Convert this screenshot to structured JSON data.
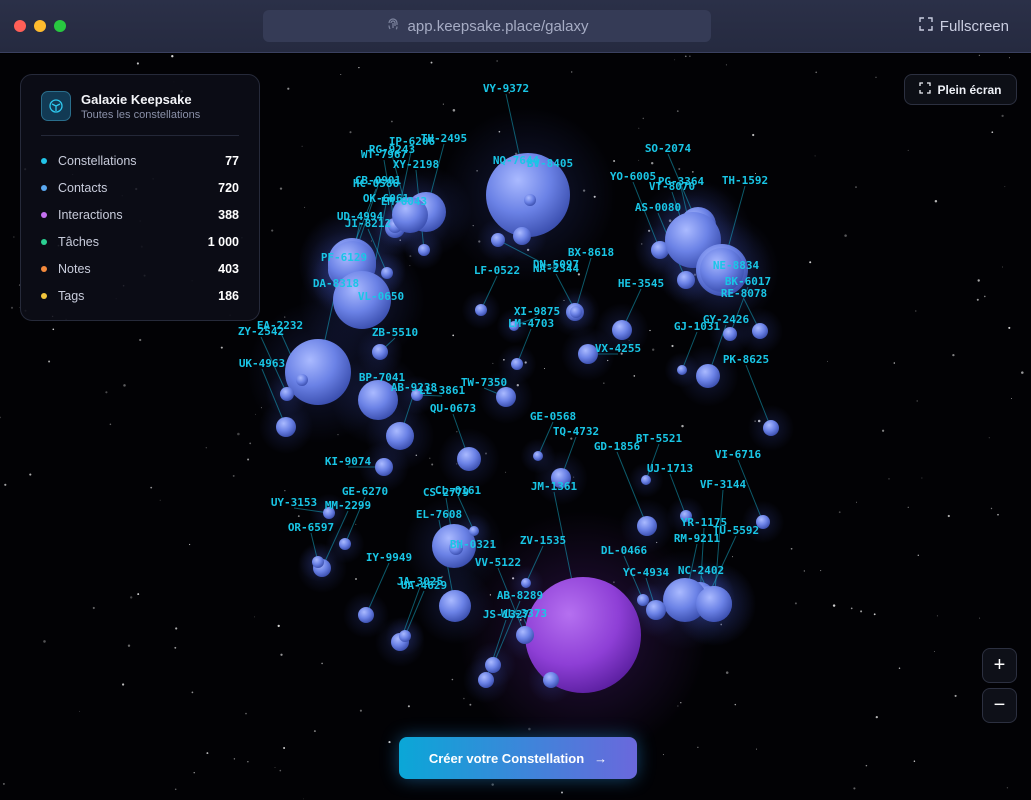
{
  "browser": {
    "url": "app.keepsake.place/galaxy",
    "fullscreen_label": "Fullscreen",
    "traffic_lights": [
      "#ff5f57",
      "#febc2e",
      "#28c840"
    ]
  },
  "panel": {
    "title": "Galaxie Keepsake",
    "subtitle": "Toutes les constellations",
    "stats": [
      {
        "label": "Constellations",
        "value": "77",
        "color": "#22c4e8"
      },
      {
        "label": "Contacts",
        "value": "720",
        "color": "#5aa8f0"
      },
      {
        "label": "Interactions",
        "value": "388",
        "color": "#c471f0"
      },
      {
        "label": "Tâches",
        "value": "1 000",
        "color": "#2bd192"
      },
      {
        "label": "Notes",
        "value": "403",
        "color": "#f48a3c"
      },
      {
        "label": "Tags",
        "value": "186",
        "color": "#f2c53c"
      }
    ]
  },
  "controls": {
    "fullscreen_label": "Plein écran",
    "zoom_in": "+",
    "zoom_out": "−",
    "cta_label": "Créer votre Constellation",
    "cta_arrow": "→"
  },
  "colors": {
    "label": "#19c6e6",
    "node": "#6f86ea",
    "node_large": "#7f7ee8",
    "center": "#9b45dc"
  },
  "nodes": [
    "VY-9372",
    "IP-6206",
    "TH-2495",
    "RG-9243",
    "WT-7967",
    "XY-2198",
    "NQ-7644",
    "BV-8405",
    "SO-2074",
    "CB-0901",
    "HC-0586",
    "OK-6061",
    "EM-6043",
    "UD-4994",
    "JI-8212",
    "YO-6005",
    "VT-8070",
    "PG-3364",
    "TH-1592",
    "AS-0080",
    "BX-8618",
    "NE-8834",
    "DN-5097",
    "NA-2344",
    "LF-0522",
    "PF-6129",
    "HE-3545",
    "BK-6017",
    "DA-8318",
    "RE-8078",
    "VL-0650",
    "XI-9875",
    "LM-4703",
    "GY-2426",
    "EA-2232",
    "ZY-2542",
    "GJ-1031",
    "ZB-5510",
    "VX-4255",
    "UK-4963",
    "PK-8625",
    "BP-7041",
    "AB-9238",
    "LL-3861",
    "TW-7350",
    "QU-0673",
    "GE-0568",
    "TQ-4732",
    "BT-5521",
    "GD-1856",
    "VI-6716",
    "KI-9074",
    "UJ-1713",
    "JM-1361",
    "GE-6270",
    "CS-2779",
    "CL-0161",
    "VF-3144",
    "UY-3153",
    "MM-2299",
    "EL-7608",
    "YR-1175",
    "TU-5592",
    "OR-6597",
    "BH-0321",
    "ZV-1535",
    "RM-9211",
    "DL-0466",
    "IY-9949",
    "VV-5122",
    "YC-4934",
    "NC-2402",
    "JA-3025",
    "UA-4629",
    "AB-8289",
    "JS-1327",
    "WL-3373"
  ]
}
